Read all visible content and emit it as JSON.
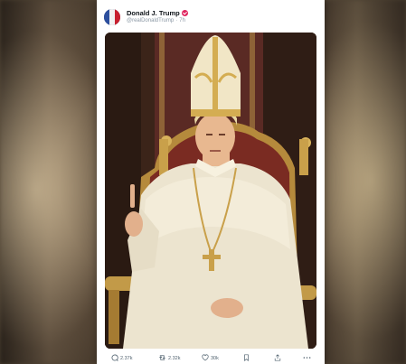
{
  "post": {
    "author_name": "Donald J. Trump",
    "handle": "@realDonaldTrump",
    "time": "7h",
    "verified_color": "#e0245e"
  },
  "actions": {
    "replies": "2.37k",
    "reposts": "2.32k",
    "likes": "30k"
  },
  "icons": [
    "avatar-flag",
    "verified-badge-icon",
    "reply-icon",
    "repost-icon",
    "like-icon",
    "bookmark-icon",
    "share-icon",
    "more-icon"
  ]
}
